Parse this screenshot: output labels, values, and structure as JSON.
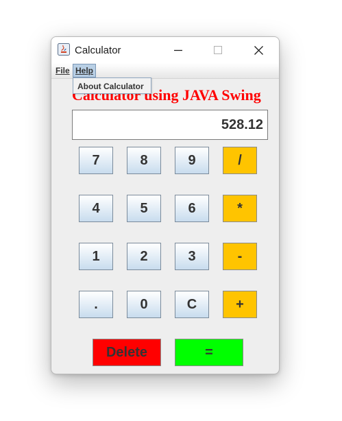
{
  "window": {
    "title": "Calculator"
  },
  "menubar": {
    "file": "File",
    "help": "Help"
  },
  "help_menu": {
    "items": [
      "About Calculator"
    ]
  },
  "app": {
    "heading": "Calculator using JAVA Swing",
    "display_value": "528.12"
  },
  "keypad": {
    "rows": [
      [
        "7",
        "8",
        "9",
        "/"
      ],
      [
        "4",
        "5",
        "6",
        "*"
      ],
      [
        "1",
        "2",
        "3",
        "-"
      ],
      [
        ".",
        "0",
        "C",
        "+"
      ]
    ],
    "delete_label": "Delete",
    "equals_label": "="
  },
  "colors": {
    "heading": "#ff0000",
    "operator_button": "#ffc400",
    "delete_button": "#ff0000",
    "equals_button": "#00ff00"
  }
}
